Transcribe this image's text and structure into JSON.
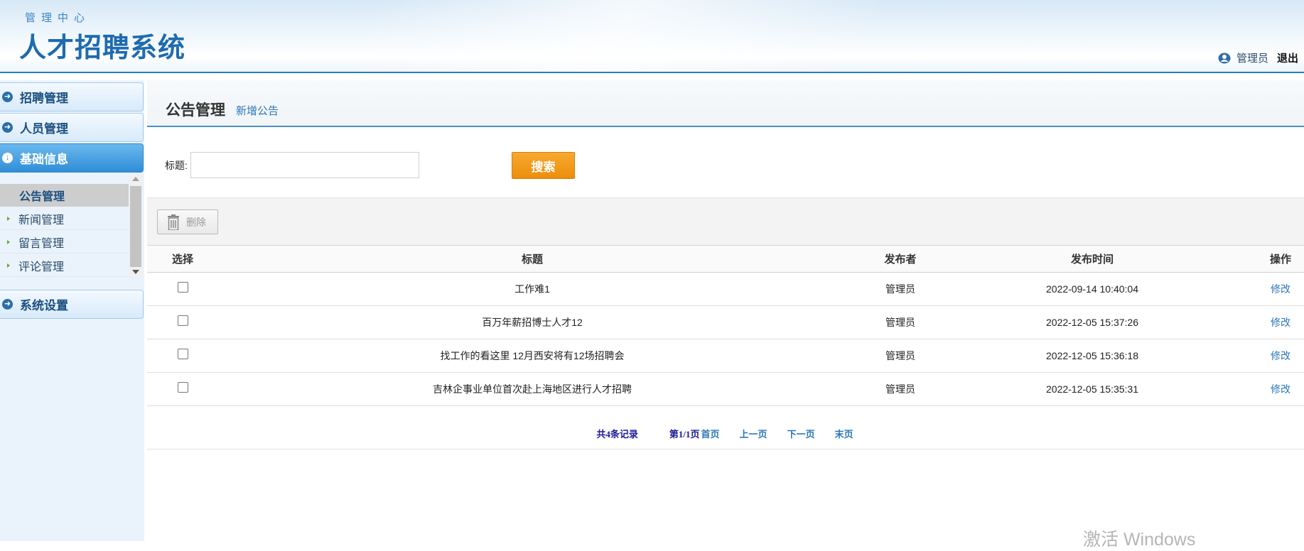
{
  "header": {
    "subtitle": "管理中心",
    "title": "人才招聘系统",
    "user_label": "管理员",
    "logout_label": "退出"
  },
  "sidebar": {
    "groups": [
      {
        "label": "招聘管理",
        "active": false
      },
      {
        "label": "人员管理",
        "active": false
      },
      {
        "label": "基础信息",
        "active": true
      },
      {
        "label": "系统设置",
        "active": false
      }
    ],
    "subitems": [
      {
        "label": "公告管理",
        "selected": true
      },
      {
        "label": "新闻管理",
        "selected": false
      },
      {
        "label": "留言管理",
        "selected": false
      },
      {
        "label": "评论管理",
        "selected": false
      }
    ]
  },
  "main": {
    "title": "公告管理",
    "add_link": "新增公告",
    "search": {
      "label": "标题:",
      "value": "",
      "button": "搜索"
    },
    "delete_button": "删除",
    "table": {
      "columns": [
        "选择",
        "标题",
        "发布者",
        "发布时间",
        "操作"
      ],
      "rows": [
        {
          "title": "工作难1",
          "publisher": "管理员",
          "time": "2022-09-14 10:40:04",
          "action": "修改"
        },
        {
          "title": "百万年薪招博士人才12",
          "publisher": "管理员",
          "time": "2022-12-05 15:37:26",
          "action": "修改"
        },
        {
          "title": "找工作的看这里 12月西安将有12场招聘会",
          "publisher": "管理员",
          "time": "2022-12-05 15:36:18",
          "action": "修改"
        },
        {
          "title": "吉林企事业单位首次赴上海地区进行人才招聘",
          "publisher": "管理员",
          "time": "2022-12-05 15:35:31",
          "action": "修改"
        }
      ]
    },
    "pager": {
      "total": "共4条记录",
      "page": "第1/1页",
      "first": "首页",
      "prev": "上一页",
      "next": "下一页",
      "last": "末页"
    }
  },
  "watermark": "激活 Windows",
  "colors": {
    "accent": "#2a7dc2",
    "search_button": "#f39c1a",
    "link": "#2a77b8"
  }
}
